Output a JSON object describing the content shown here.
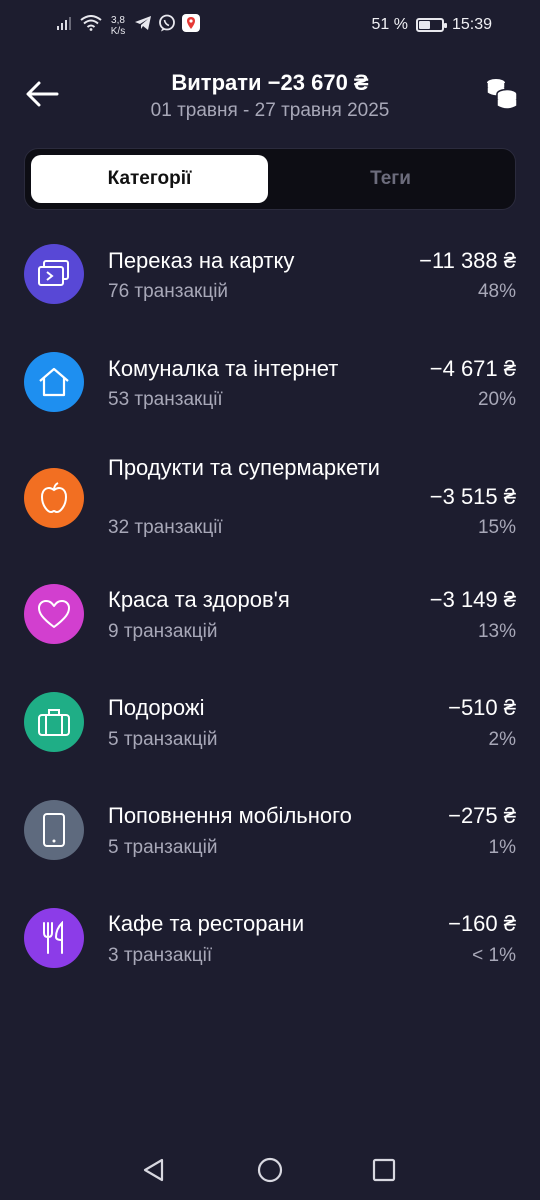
{
  "status_bar": {
    "net_speed_value": "3,8",
    "net_speed_unit": "K/s",
    "battery_text": "51 %",
    "battery_level": 0.51,
    "time": "15:39"
  },
  "header": {
    "title": "Витрати −23 670 ₴",
    "date_range": "01 травня - 27 травня 2025",
    "back_icon": "arrow-left-icon",
    "right_icon": "coins-stack-icon"
  },
  "tabs": [
    {
      "label": "Категорії",
      "active": true
    },
    {
      "label": "Теги",
      "active": false
    }
  ],
  "categories": [
    {
      "name": "Переказ на картку",
      "count": "76 транзакцій",
      "amount": "−11 388 ₴",
      "percent": "48%",
      "icon": "card-transfer-icon",
      "color": "#5848d6"
    },
    {
      "name": "Комуналка та інтернет",
      "count": "53 транзакції",
      "amount": "−4 671 ₴",
      "percent": "20%",
      "icon": "house-icon",
      "color": "#1e8ff0"
    },
    {
      "name": "Продукти та супермаркети",
      "count": "32 транзакції",
      "amount": "−3 515 ₴",
      "percent": "15%",
      "icon": "apple-icon",
      "color": "#f26f22"
    },
    {
      "name": "Краса та здоров'я",
      "count": "9 транзакцій",
      "amount": "−3 149 ₴",
      "percent": "13%",
      "icon": "heart-icon",
      "color": "#d23fcf"
    },
    {
      "name": "Подорожі",
      "count": "5 транзакцій",
      "amount": "−510 ₴",
      "percent": "2%",
      "icon": "suitcase-icon",
      "color": "#1fae86"
    },
    {
      "name": "Поповнення мобільного",
      "count": "5 транзакцій",
      "amount": "−275 ₴",
      "percent": "1%",
      "icon": "phone-icon",
      "color": "#5e6a7e"
    },
    {
      "name": "Кафе та ресторани",
      "count": "3 транзакції",
      "amount": "−160 ₴",
      "percent": "< 1%",
      "icon": "cutlery-icon",
      "color": "#8c3ce8"
    }
  ],
  "nav": {
    "back": "nav-back-icon",
    "home": "nav-home-icon",
    "recents": "nav-recents-icon"
  }
}
